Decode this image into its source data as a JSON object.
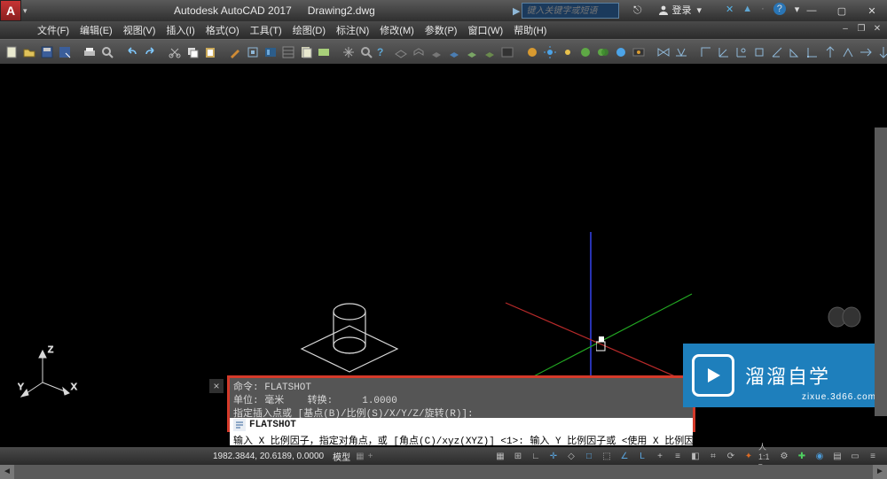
{
  "titlebar": {
    "app": "Autodesk AutoCAD 2017",
    "doc": "Drawing2.dwg",
    "search_placeholder": "键入关键字或短语",
    "account": "登录"
  },
  "menus": {
    "file": "文件(F)",
    "edit": "编辑(E)",
    "view": "视图(V)",
    "insert": "插入(I)",
    "format": "格式(O)",
    "tools": "工具(T)",
    "draw": "绘图(D)",
    "dim": "标注(N)",
    "modify": "修改(M)",
    "param": "参数(P)",
    "window": "窗口(W)",
    "help": "帮助(H)"
  },
  "cmd": {
    "l1": "命令: FLATSHOT",
    "l2_a": "单位: 毫米",
    "l2_b": "转换:",
    "l2_c": "1.0000",
    "l3": "指定插入点或 [基点(B)/比例(S)/X/Y/Z/旋转(R)]:",
    "flat": "FLATSHOT",
    "prompt": "输入 X 比例因子，指定对角点，或 [角点(C)/xyz(XYZ)] <1>:   输入 Y 比例因子或 <使用 X 比例因子>:"
  },
  "status": {
    "coords": "1982.3844, 20.6189, 0.0000",
    "mode": "模型"
  },
  "watermark": {
    "brand": "溜溜自学",
    "url": "zixue.3d66.com"
  },
  "ucs": {
    "x": "X",
    "y": "Y",
    "z": "Z"
  }
}
